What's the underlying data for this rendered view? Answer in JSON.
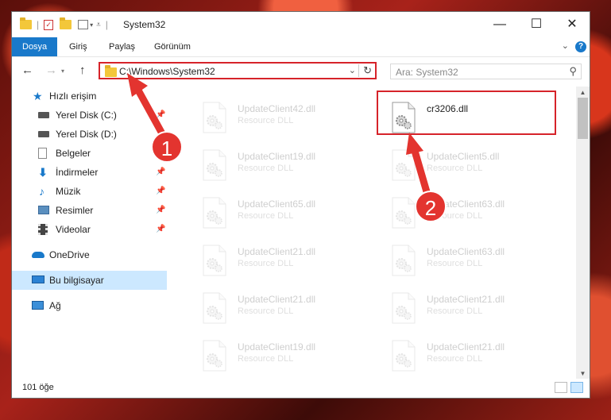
{
  "window": {
    "title": "System32",
    "controls": {
      "minimize": "—",
      "maximize": "☐",
      "close": "✕"
    }
  },
  "ribbon": {
    "tabs": [
      {
        "label": "Dosya",
        "active": true
      },
      {
        "label": "Giriş"
      },
      {
        "label": "Paylaş"
      },
      {
        "label": "Görünüm"
      }
    ]
  },
  "address": {
    "path": "C:\\Windows\\System32",
    "search_placeholder": "Ara: System32"
  },
  "sidebar": {
    "quick_access": "Hızlı erişim",
    "items": [
      {
        "label": "Yerel Disk (C:)",
        "icon": "drive-icon",
        "pinned": true
      },
      {
        "label": "Yerel Disk (D:)",
        "icon": "drive-icon",
        "pinned": false
      },
      {
        "label": "Belgeler",
        "icon": "documents-icon",
        "pinned": true
      },
      {
        "label": "İndirmeler",
        "icon": "download-icon",
        "pinned": true
      },
      {
        "label": "Müzik",
        "icon": "music-icon",
        "pinned": true
      },
      {
        "label": "Resimler",
        "icon": "pictures-icon",
        "pinned": true
      },
      {
        "label": "Videolar",
        "icon": "videos-icon",
        "pinned": true
      }
    ],
    "onedrive": "OneDrive",
    "this_pc": "Bu bilgisayar",
    "network": "Ağ"
  },
  "files": {
    "left": [
      {
        "name": "UpdateClient42.dll",
        "type": "Resource DLL"
      },
      {
        "name": "UpdateClient19.dll",
        "type": "Resource DLL"
      },
      {
        "name": "UpdateClient65.dll",
        "type": "Resource DLL"
      },
      {
        "name": "UpdateClient21.dll",
        "type": "Resource DLL"
      },
      {
        "name": "UpdateClient21.dll",
        "type": "Resource DLL"
      },
      {
        "name": "UpdateClient19.dll",
        "type": "Resource DLL"
      }
    ],
    "right": [
      {
        "name": "cr3206.dll",
        "type": ""
      },
      {
        "name": "UpdateClient5.dll",
        "type": "Resource DLL"
      },
      {
        "name": "UpdateClient63.dll",
        "type": "Resource DLL"
      },
      {
        "name": "UpdateClient63.dll",
        "type": "Resource DLL"
      },
      {
        "name": "UpdateClient21.dll",
        "type": "Resource DLL"
      },
      {
        "name": "UpdateClient21.dll",
        "type": "Resource DLL"
      }
    ]
  },
  "status": {
    "count": "101 öğe"
  },
  "callouts": [
    "1",
    "2"
  ],
  "colors": {
    "accent": "#1979ca",
    "highlight": "#d6232a",
    "callout": "#e3342f",
    "selected": "#cce8ff"
  }
}
